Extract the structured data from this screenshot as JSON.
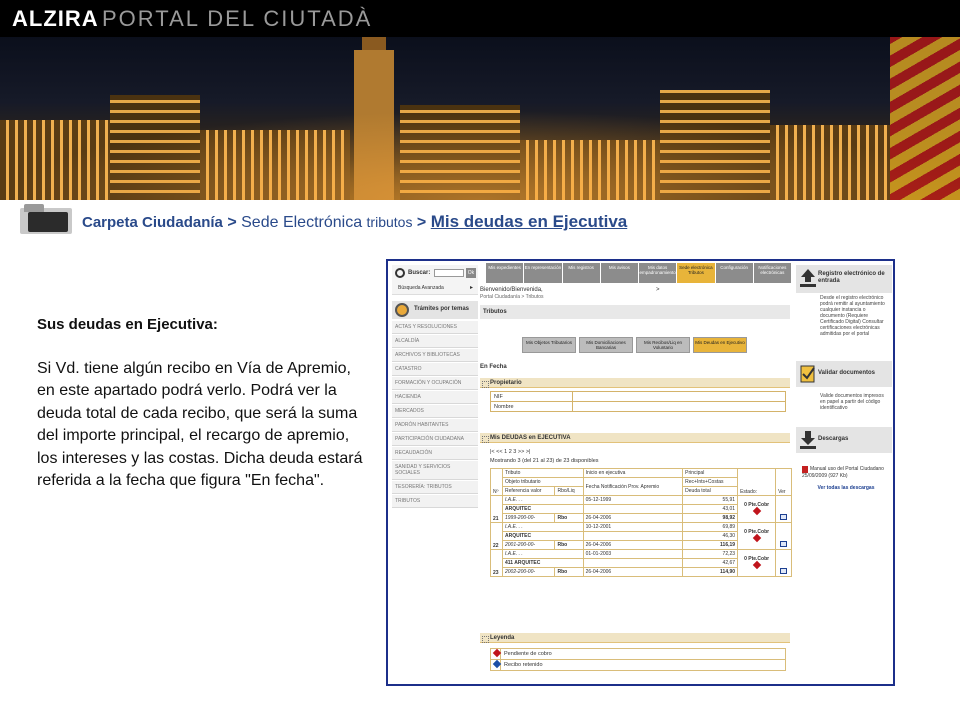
{
  "header": {
    "brand": "ALZIRA",
    "subtitle": "PORTAL DEL CIUTADÀ"
  },
  "breadcrumb": {
    "item1": "Carpeta Ciudadanía",
    "sep1": ">",
    "item2_main": "Sede Electrónica",
    "item2_small": "tributos",
    "sep2": ">",
    "item3": "Mis deudas en Ejecutiva"
  },
  "intro": {
    "title": "Sus deudas en Ejecutiva:",
    "body": "Si Vd. tiene algún recibo en Vía de Apremio, en este apartado podrá verlo. Podrá ver la deuda total de cada recibo, que será la suma del importe principal, el recargo de apremio, los intereses y las costas. Dicha deuda estará referida a la fecha que figura \"En fecha\"."
  },
  "shot": {
    "search_label": "Buscar:",
    "search_ok": "Ok",
    "advanced": "Búsqueda Avanzada",
    "advanced_arrow": "▸",
    "themes_label": "Trámites por temas",
    "menu": [
      "Actas y resoluciones",
      "Alcaldía",
      "Archivos y bibliotecas",
      "Catastro",
      "Formación y ocupación",
      "Hacienda",
      "Mercados",
      "Padrón habitantes",
      "Participación ciudadana",
      "Recaudación",
      "Sanidad y servicios sociales",
      "Tesorería: Tributos",
      "Tributos"
    ],
    "tabs": [
      "Mis expedientes",
      "En representación",
      "Mis registros",
      "Mis avisos",
      "Mis datos empadronamiento",
      "Sede electrónica Tributos",
      "Configuración",
      "Notificaciones electrónicas"
    ],
    "welcome": "Bienvenido/Bienvenida,",
    "welcome_gt": ">",
    "welcome_sub": "Portal Ciudadanía > Tributos",
    "section": "Tributos",
    "buttons": [
      "Mis Objetos Tributarios",
      "Mis Domiciliaciones Bancarias",
      "Mis Recibos/Liq en Voluntario",
      "Mis Deudas en Ejecutivo"
    ],
    "en_fecha": "En Fecha",
    "propietario": "Propietario",
    "nif": "NIF",
    "nombre": "Nombre",
    "deudas_title": "Mis DEUDAS en EJECUTIVA",
    "pager": "|< << 1 2 3 >> >|",
    "showing": "Mostrando 3 (del 21 al 23) de 23 disponibles",
    "cols": {
      "n": "Nº",
      "tributo": "Tributo",
      "objeto": "Objeto tributario",
      "ref": "Referencia valor",
      "rbo": "Rbo/Liq",
      "inicio": "Inicio en ejecutiva",
      "fecha_not": "Fecha Notificación Prov. Apremio",
      "principal": "Principal",
      "rec": "Rec+Ints+Costas",
      "total": "Deuda total",
      "estado": "Estado:",
      "ver": "Ver"
    },
    "rows": [
      {
        "n": "21",
        "tributo": "I.A.E. . .",
        "objeto": "ARQUITEC",
        "ref": "1999-200-00-",
        "rbo": "Rbo",
        "inicio": "05-12-1999",
        "fecha": "26-04-2006",
        "principal": "55,91",
        "rec": "43,01",
        "total": "98,92",
        "estado": "0 Pte.Cobr"
      },
      {
        "n": "22",
        "tributo": "I.A.E. . .",
        "objeto": "ARQUITEC",
        "ref": "2001-200-00-",
        "rbo": "Rbo",
        "inicio": "10-12-2001",
        "fecha": "26-04-2006",
        "principal": "69,89",
        "rec": "46,30",
        "total": "116,19",
        "estado": "0 Pte.Cobr"
      },
      {
        "n": "23",
        "tributo": "I.A.E. . .",
        "objeto": "411 ARQUITEC",
        "ref": "2002-200-00-",
        "rbo": "Rbo",
        "inicio": "01-01-2003",
        "fecha": "26-04-2006",
        "principal": "72,23",
        "rec": "42,67",
        "total": "114,90",
        "estado": "0 Pte.Cobr"
      }
    ],
    "leyenda": "Leyenda",
    "leg1": "Pendiente de cobro",
    "leg2": "Recibo retenido",
    "right": {
      "registro": "Registro electrónico de entrada",
      "registro_txt": "Desde el registro electrónico podrá remitir al ayuntamiento cualquier instancia o documento (Requiere Certificado Digital) Consultar certificaciones electrónicas admitidas por el portal",
      "validar": "Validar documentos",
      "validar_txt": "Valide documentos impresos en papel a partir del código identificativo",
      "descargas": "Descargas",
      "manual": "Manual uso del Portal Ciudadano 25/09/2009 (927 Kb)",
      "ver_todas": "Ver todas las descargas"
    }
  }
}
